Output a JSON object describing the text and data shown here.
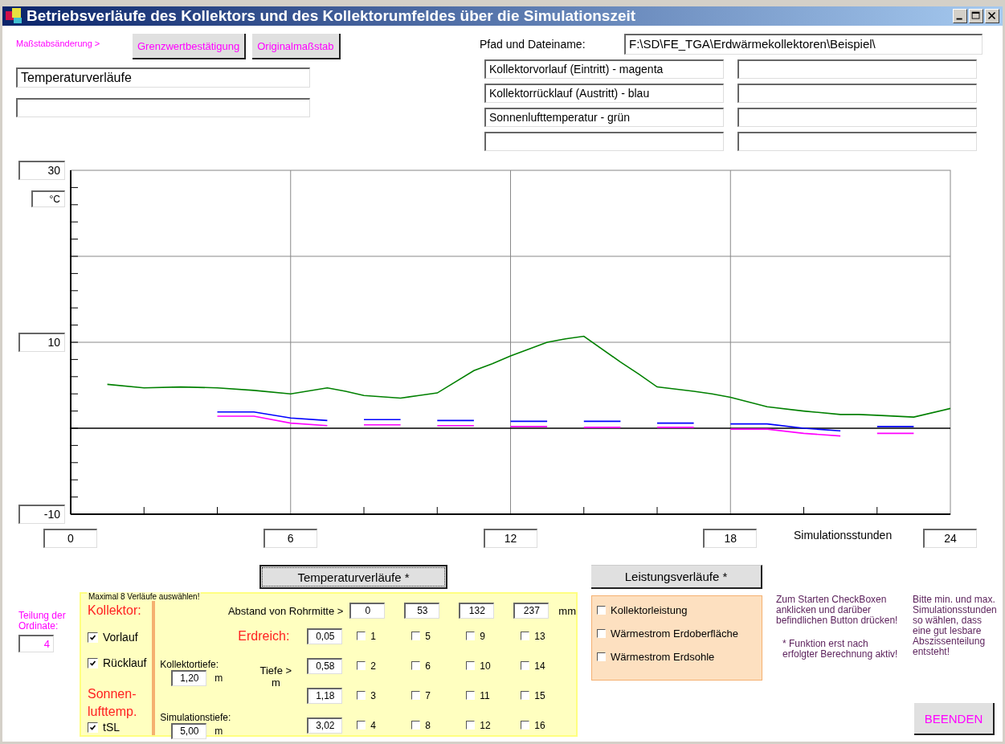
{
  "window": {
    "title": "Betriebsverläufe des Kollektors und des Kollektorumfeldes über die Simulationszeit"
  },
  "scale": {
    "label": "Maßstabsänderung >",
    "buttons": [
      "Grenzwertbestätigung",
      "Originalmaßstab"
    ]
  },
  "diagram_title": "Temperaturverläufe",
  "path": {
    "label": "Pfad und Dateiname:",
    "value": "F:\\SD\\FE_TGA\\Erdwärmekollektoren\\Beispiel\\"
  },
  "legend": [
    "Kollektorvorlauf (Eintritt) - magenta",
    "Kollektorrücklauf (Austritt) - blau",
    "Sonnenlufttemperatur - grün"
  ],
  "chart": {
    "chart_data": {
      "type": "line",
      "xlabel": "Simulationsstunden",
      "ylabel": "°C",
      "x": [
        1,
        2,
        3,
        4,
        5,
        6,
        7,
        7.5,
        8,
        9,
        9.5,
        10,
        11,
        11.5,
        12,
        13,
        13.5,
        14,
        15,
        15.5,
        16,
        17,
        17.5,
        18,
        19,
        20,
        21,
        21.5,
        22,
        23,
        24
      ],
      "series": [
        {
          "color": "#ff00ff",
          "values": [
            null,
            null,
            null,
            1.4,
            1.4,
            0.6,
            0.3,
            null,
            0.4,
            0.4,
            null,
            0.3,
            0.3,
            null,
            0.2,
            0.2,
            null,
            0.1,
            0.1,
            null,
            0.1,
            0.1,
            null,
            -0.1,
            -0.1,
            -0.6,
            -0.9,
            null,
            -0.6,
            -0.6,
            null
          ]
        },
        {
          "color": "#0000ff",
          "values": [
            null,
            null,
            null,
            1.9,
            1.9,
            1.2,
            0.9,
            null,
            1.0,
            1.0,
            null,
            0.9,
            0.9,
            null,
            0.8,
            0.8,
            null,
            0.8,
            0.8,
            null,
            0.6,
            0.6,
            null,
            0.5,
            0.5,
            0.0,
            -0.3,
            null,
            0.2,
            0.2,
            null
          ]
        },
        {
          "color": "#008000",
          "values": [
            5.1,
            4.7,
            4.8,
            4.7,
            4.4,
            4.0,
            4.7,
            4.3,
            3.8,
            3.5,
            3.8,
            4.1,
            6.7,
            7.5,
            8.4,
            10.0,
            10.4,
            10.7,
            7.7,
            6.3,
            4.8,
            4.3,
            4.0,
            3.6,
            2.5,
            2.0,
            1.6,
            1.6,
            1.5,
            1.3,
            2.3
          ]
        }
      ],
      "grid": true,
      "xlim": [
        0,
        24
      ],
      "ylim": [
        -10,
        30
      ],
      "xticks": [
        0,
        6,
        12,
        18,
        24
      ],
      "yticks": [
        -10,
        10,
        30
      ]
    }
  },
  "ordinate": {
    "label": "Teilung der Ordinate:",
    "value": "4"
  },
  "temperature_button": "Temperaturverläufe *",
  "temperature_panel": {
    "caption": "Maximal 8 Verläufe auswählen!",
    "collector_heading": "Kollektor:",
    "collector_checks": [
      {
        "label": "Vorlauf",
        "checked": true
      },
      {
        "label": "Rücklauf",
        "checked": true
      }
    ],
    "air_heading": "Sonnen-lufttemp.",
    "air_checks": [
      {
        "label": "tSL",
        "checked": true
      }
    ],
    "distance_label": "Abstand von Rohrmitte >",
    "distances": [
      "0",
      "53",
      "132",
      "237"
    ],
    "distance_unit": "mm",
    "soil_heading": "Erdreich:",
    "depth_label": "Tiefe >",
    "depth_unit": "m",
    "collector_depth": {
      "label": "Kollektortiefe:",
      "value": "1,20",
      "unit": "m"
    },
    "simulation_depth": {
      "label": "Simulationstiefe:",
      "value": "5,00",
      "unit": "m"
    },
    "depth_rows": [
      {
        "depth": "0,05",
        "checks": [
          {
            "label": "1",
            "checked": false
          },
          {
            "label": "5",
            "checked": false
          },
          {
            "label": "9",
            "checked": false
          },
          {
            "label": "13",
            "checked": false
          }
        ]
      },
      {
        "depth": "0,58",
        "checks": [
          {
            "label": "2",
            "checked": false
          },
          {
            "label": "6",
            "checked": false
          },
          {
            "label": "10",
            "checked": false
          },
          {
            "label": "14",
            "checked": false
          }
        ]
      },
      {
        "depth": "1,18",
        "checks": [
          {
            "label": "3",
            "checked": false
          },
          {
            "label": "7",
            "checked": false
          },
          {
            "label": "11",
            "checked": false
          },
          {
            "label": "15",
            "checked": false
          }
        ]
      },
      {
        "depth": "3,02",
        "checks": [
          {
            "label": "4",
            "checked": false
          },
          {
            "label": "8",
            "checked": false
          },
          {
            "label": "12",
            "checked": false
          },
          {
            "label": "16",
            "checked": false
          }
        ]
      }
    ]
  },
  "power_button": "Leistungsverläufe *",
  "power_checks": [
    {
      "label": "Kollektorleistung",
      "checked": false
    },
    {
      "label": "Wärmestrom Erdoberfläche",
      "checked": false
    },
    {
      "label": "Wärmestrom Erdsohle",
      "checked": false
    }
  ],
  "notes": [
    "Zum Starten CheckBoxen anklicken und darüber befindlichen Button drücken!",
    "* Funktion erst nach erfolgter Berechnung aktiv!",
    "Bitte min. und max. Simulationsstunden so wählen, dass eine gut lesbare Abszissenteilung entsteht!"
  ],
  "exit_button": "BEENDEN"
}
